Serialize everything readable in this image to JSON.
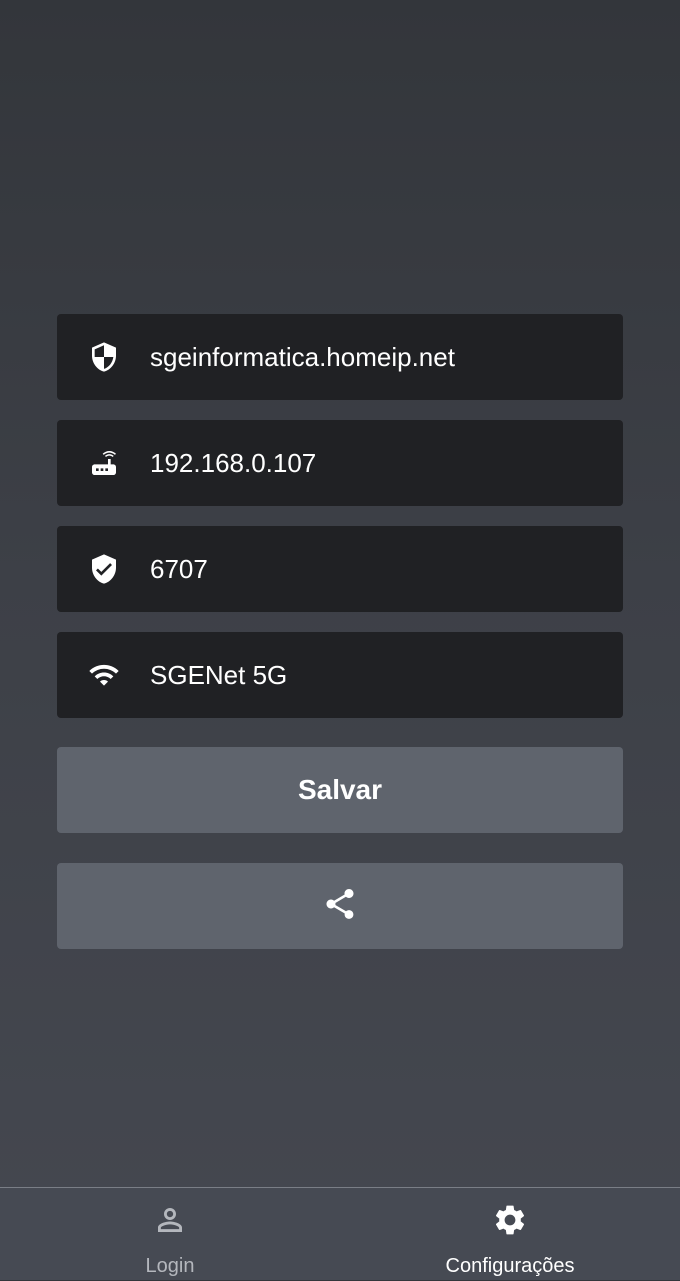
{
  "form": {
    "fields": [
      {
        "icon": "shield-half-icon",
        "value": "sgeinformatica.homeip.net"
      },
      {
        "icon": "router-icon",
        "value": "192.168.0.107"
      },
      {
        "icon": "verified-shield-icon",
        "value": "6707"
      },
      {
        "icon": "wifi-icon",
        "value": "SGENet 5G"
      }
    ],
    "save_label": "Salvar",
    "share_icon": "share-icon"
  },
  "bottom_nav": {
    "items": [
      {
        "label": "Login",
        "icon": "person-icon",
        "active": false
      },
      {
        "label": "Configurações",
        "icon": "gear-icon",
        "active": true
      }
    ]
  },
  "colors": {
    "field_background": "#202124",
    "button_background": "#5f646d",
    "nav_background": "#464a53",
    "text": "#ffffff",
    "inactive_nav": "#b4b7bd"
  }
}
